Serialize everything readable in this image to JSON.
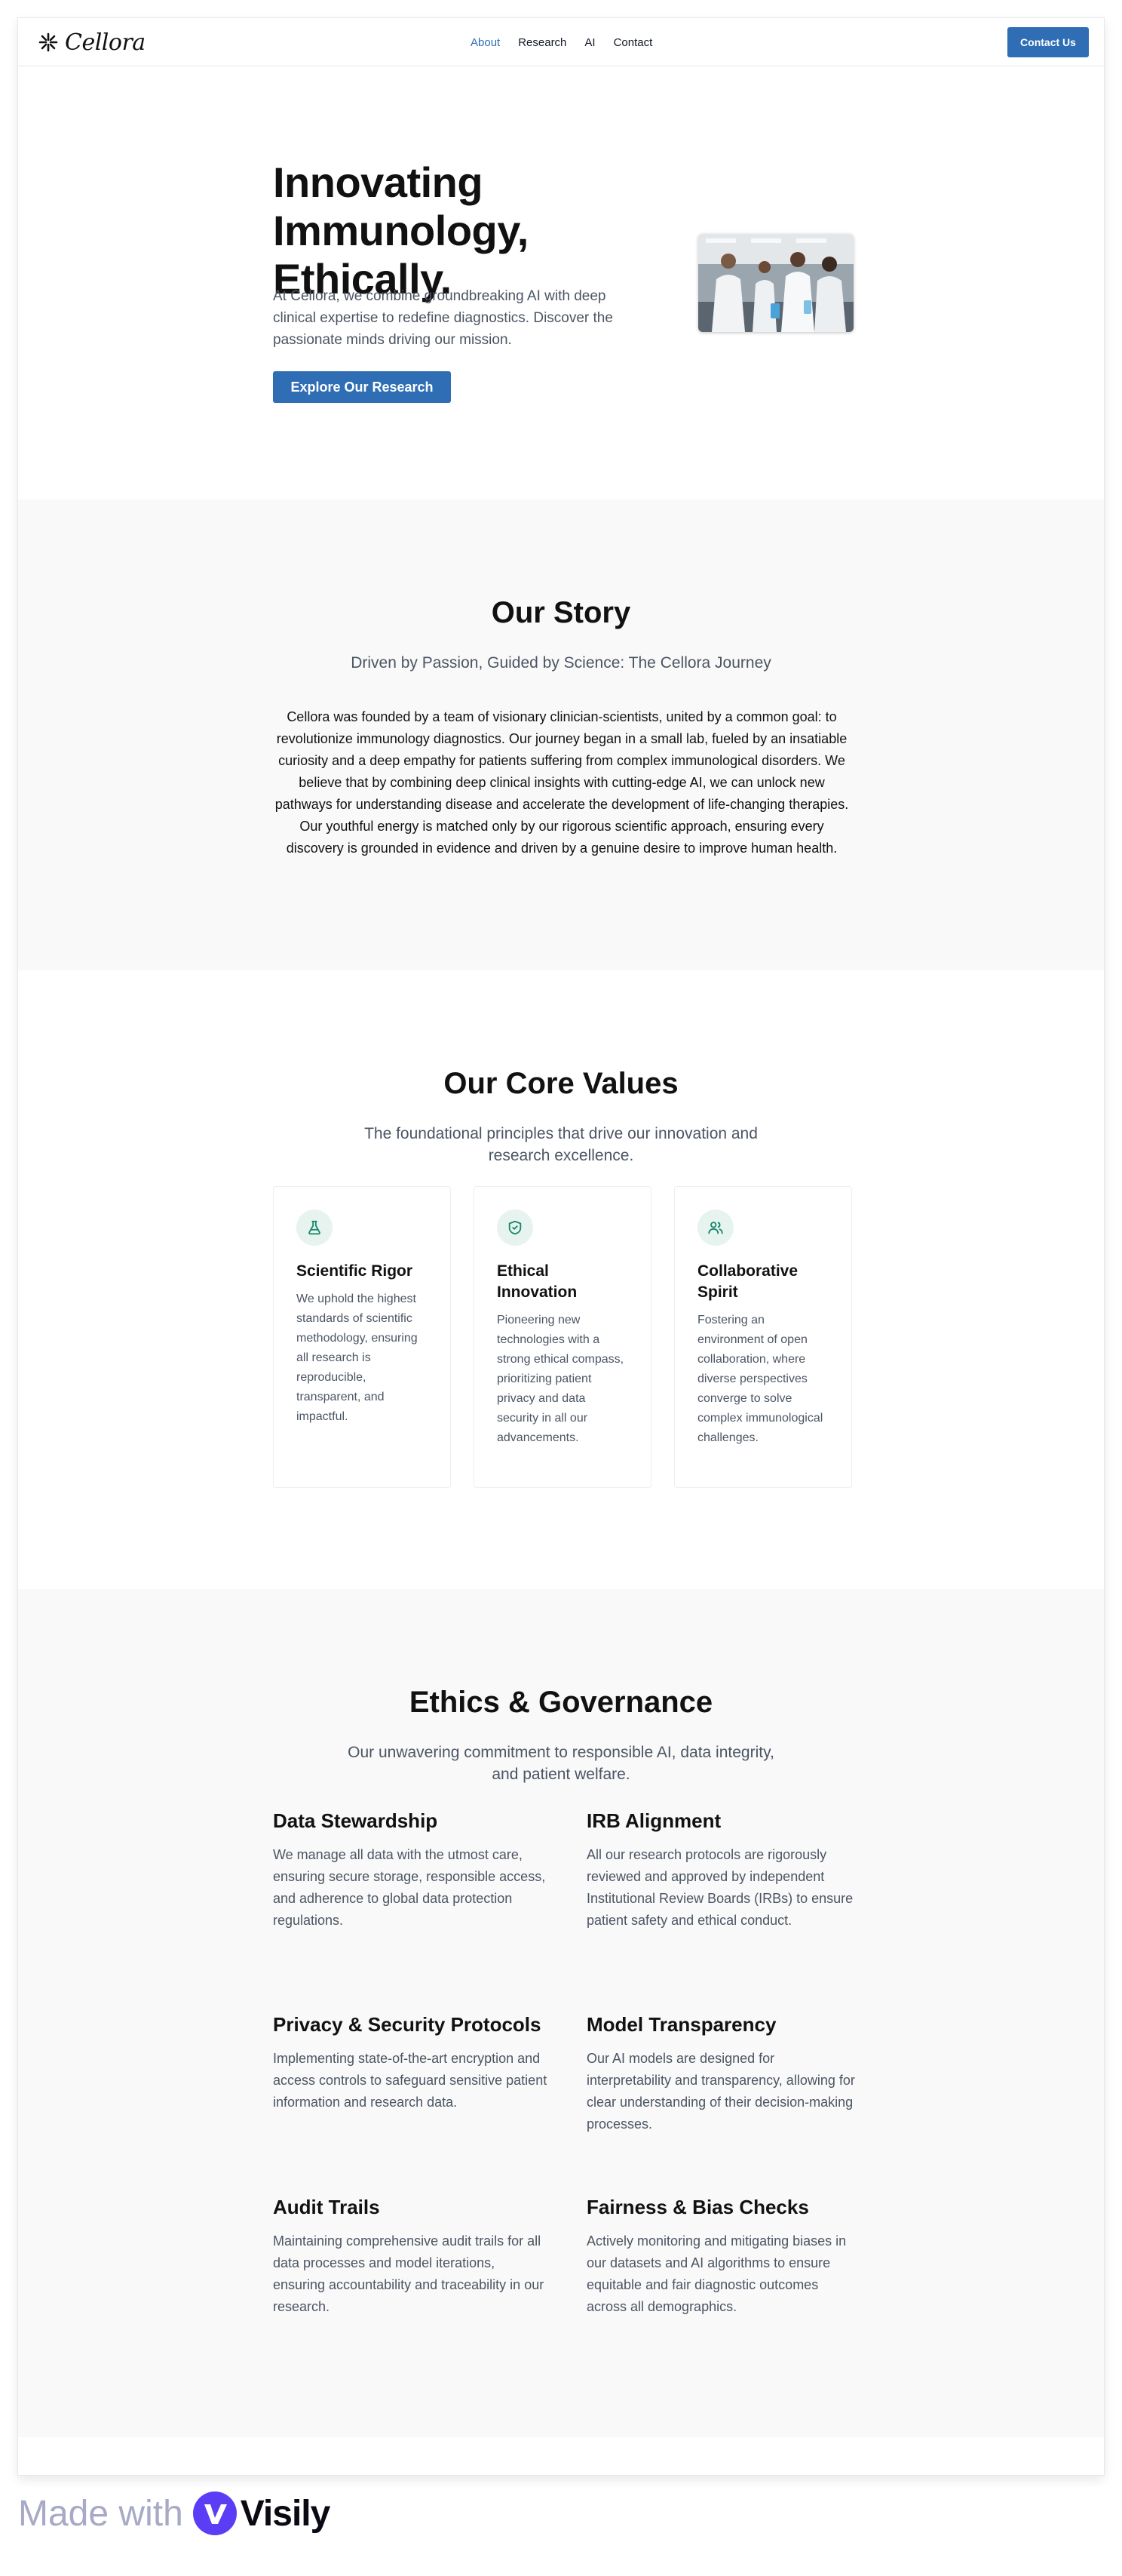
{
  "brand": {
    "name": "Cellora"
  },
  "nav": {
    "links": [
      "About",
      "Research",
      "AI",
      "Contact"
    ],
    "active": "About",
    "contact_button": "Contact Us"
  },
  "hero": {
    "title_lines": [
      "Innovating",
      "Immunology,",
      "Ethically."
    ],
    "subtitle": "At Cellora, we combine groundbreaking AI with deep clinical expertise to redefine diagnostics. Discover the passionate minds driving our mission.",
    "cta": "Explore Our Research"
  },
  "story": {
    "title": "Our Story",
    "subtitle": "Driven by Passion, Guided by Science: The Cellora Journey",
    "body": "Cellora was founded by a team of visionary clinician-scientists, united by a common goal: to revolutionize immunology diagnostics. Our journey began in a small lab, fueled by an insatiable curiosity and a deep empathy for patients suffering from complex immunological disorders. We believe that by combining deep clinical insights with cutting-edge AI, we can unlock new pathways for understanding disease and accelerate the development of life-changing therapies. Our youthful energy is matched only by our rigorous scientific approach, ensuring every discovery is grounded in evidence and driven by a genuine desire to improve human health."
  },
  "values": {
    "title": "Our Core Values",
    "subtitle": "The foundational principles that drive our innovation and research excellence.",
    "cards": [
      {
        "icon": "flask-icon",
        "title": "Scientific Rigor",
        "text": "We uphold the highest standards of scientific methodology, ensuring all research is reproducible, transparent, and impactful."
      },
      {
        "icon": "shield-check-icon",
        "title": "Ethical Innovation",
        "text": "Pioneering new technologies with a strong ethical compass, prioritizing patient privacy and data security in all our advancements."
      },
      {
        "icon": "users-icon",
        "title": "Collaborative Spirit",
        "text": "Fostering an environment of open collaboration, where diverse perspectives converge to solve complex immunological challenges."
      }
    ]
  },
  "ethics": {
    "title": "Ethics & Governance",
    "subtitle": "Our unwavering commitment to responsible AI, data integrity, and patient welfare.",
    "items": [
      {
        "title": "Data Stewardship",
        "text": "We manage all data with the utmost care, ensuring secure storage, responsible access, and adherence to global data protection regulations."
      },
      {
        "title": "IRB Alignment",
        "text": "All our research protocols are rigorously reviewed and approved by independent Institutional Review Boards (IRBs) to ensure patient safety and ethical conduct."
      },
      {
        "title": "Privacy & Security Protocols",
        "text": "Implementing state-of-the-art encryption and access controls to safeguard sensitive patient information and research data."
      },
      {
        "title": "Model Transparency",
        "text": "Our AI models are designed for interpretability and transparency, allowing for clear understanding of their decision-making processes."
      },
      {
        "title": "Audit Trails",
        "text": "Maintaining comprehensive audit trails for all data processes and model iterations, ensuring accountability and traceability in our research."
      },
      {
        "title": "Fairness & Bias Checks",
        "text": "Actively monitoring and mitigating biases in our datasets and AI algorithms to ensure equitable and fair diagnostic outcomes across all demographics."
      }
    ]
  },
  "footer": {
    "made_with": "Made with",
    "brand": "Visily"
  },
  "colors": {
    "accent": "#2f6eb5",
    "icon_bg": "#e7f3ef",
    "icon_stroke": "#16876a",
    "section_bg": "#f9f9f9"
  }
}
